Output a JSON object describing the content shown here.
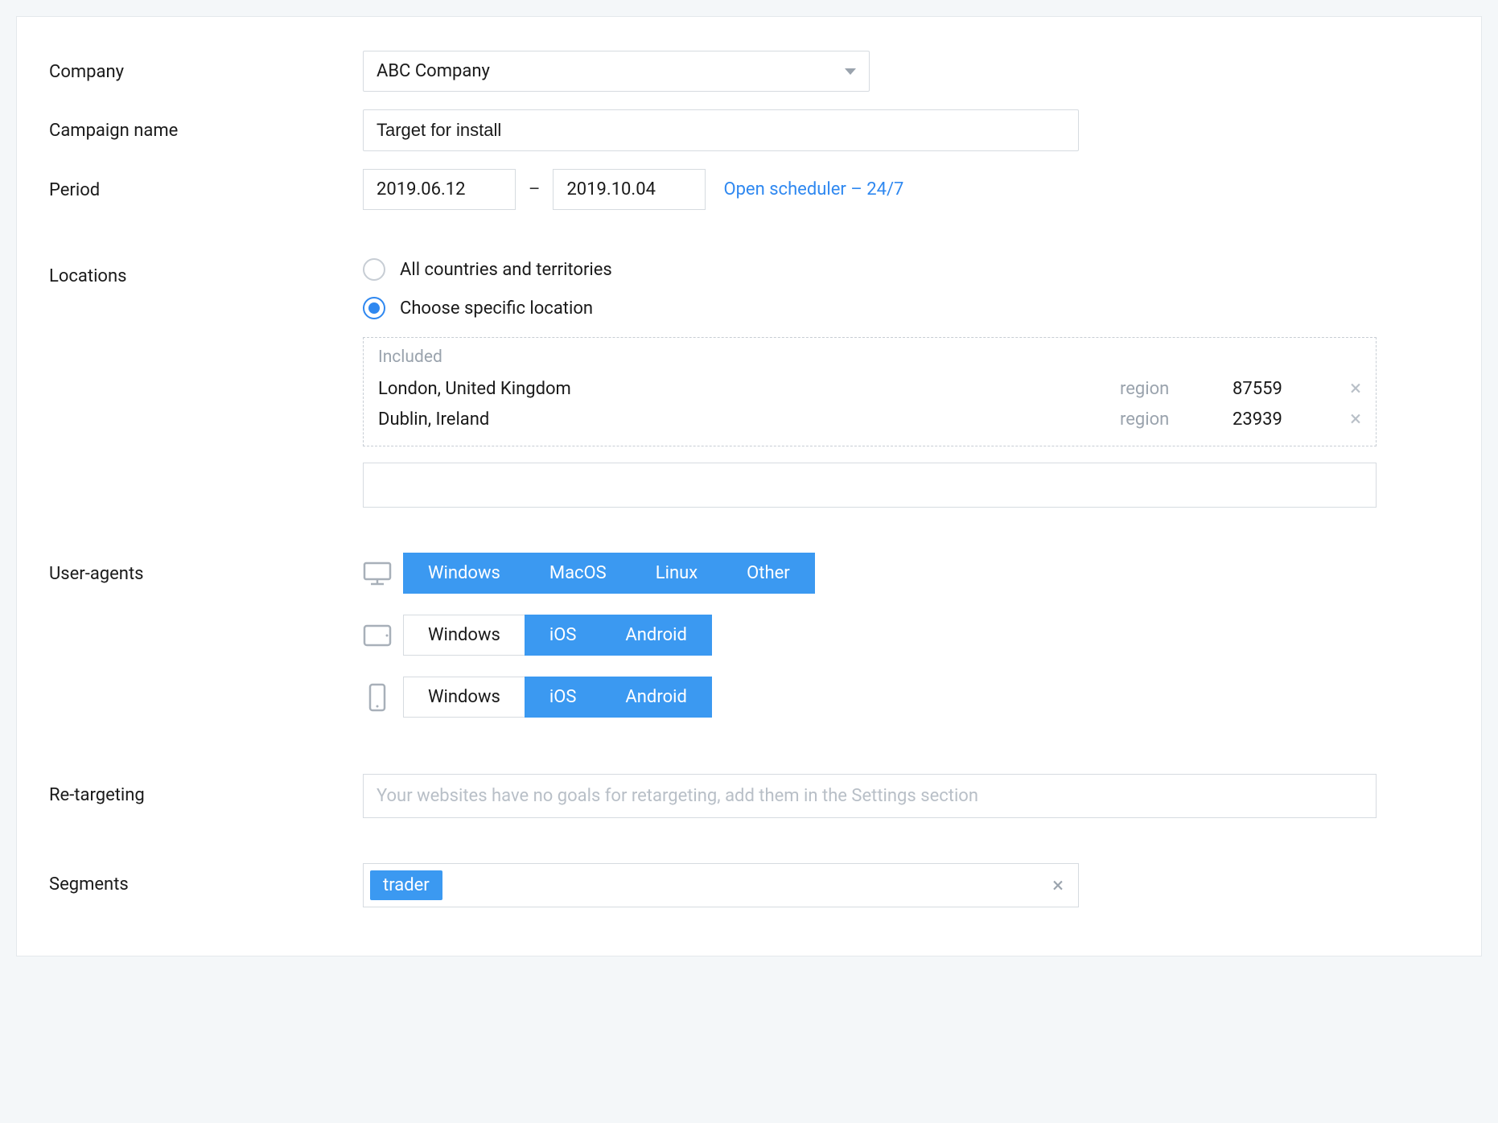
{
  "labels": {
    "company": "Company",
    "campaign_name": "Campaign name",
    "period": "Period",
    "locations": "Locations",
    "user_agents": "User-agents",
    "re_targeting": "Re-targeting",
    "segments": "Segments"
  },
  "company": {
    "selected": "ABC Company"
  },
  "campaign_name": {
    "value": "Target for install"
  },
  "period": {
    "start": "2019.06.12",
    "end": "2019.10.04",
    "separator": "–",
    "scheduler_link": "Open scheduler – 24/7"
  },
  "locations": {
    "option_all": "All countries and territories",
    "option_specific": "Choose specific location",
    "included_header": "Included",
    "items": [
      {
        "name": "London, United Kingdom",
        "type": "region",
        "count": "87559"
      },
      {
        "name": "Dublin, Ireland",
        "type": "region",
        "count": "23939"
      }
    ]
  },
  "user_agents": {
    "desktop": [
      "Windows",
      "MacOS",
      "Linux",
      "Other"
    ],
    "desktop_active": [
      true,
      true,
      true,
      true
    ],
    "tablet": [
      "Windows",
      "iOS",
      "Android"
    ],
    "tablet_active": [
      false,
      true,
      true
    ],
    "mobile": [
      "Windows",
      "iOS",
      "Android"
    ],
    "mobile_active": [
      false,
      true,
      true
    ]
  },
  "re_targeting": {
    "placeholder": "Your websites have no goals for retargeting, add them in the Settings section"
  },
  "segments": {
    "chips": [
      "trader"
    ]
  }
}
